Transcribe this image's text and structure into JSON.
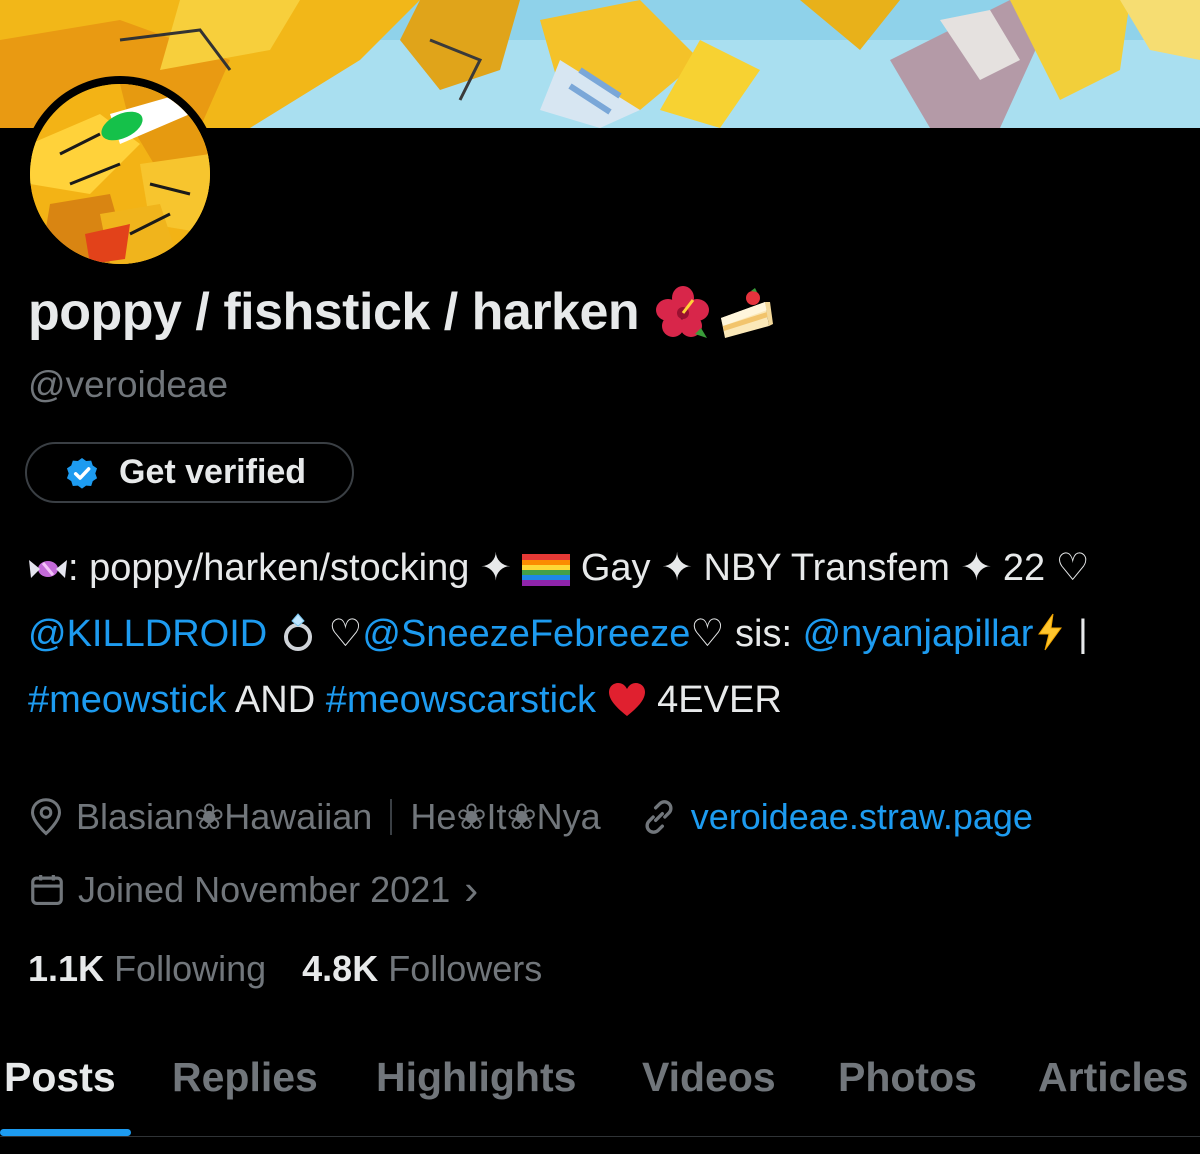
{
  "profile": {
    "display_name": "poppy / fishstick / harken",
    "name_emojis": [
      "hibiscus-icon",
      "cake-icon"
    ],
    "handle": "@veroideae",
    "get_verified_label": "Get verified"
  },
  "bio": {
    "t1": ": poppy/harken/stocking ✦ ",
    "t2": " Gay ✦ NBY Transfem ✦ 22 ♡ ",
    "mention1": "@KILLDROID",
    "t3": " ",
    "t4": " ♡",
    "mention2": "@SneezeFebreeze",
    "t5": "♡ sis: ",
    "mention3": "@nyanjapillar",
    "t6": " | ",
    "hashtag1": "#meowstick",
    "t7": " AND ",
    "hashtag2": "#meowscarstick",
    "t8": " ",
    "t9": " 4EVER"
  },
  "meta": {
    "location": "Blasian❀Hawaiian",
    "pronouns": "He❀It❀Nya",
    "website": "veroideae.straw.page",
    "joined": "Joined November 2021",
    "joined_chevron": "›"
  },
  "stats": {
    "following_count": "1.1K",
    "following_label": "Following",
    "followers_count": "4.8K",
    "followers_label": "Followers"
  },
  "tabs": [
    {
      "label": "Posts",
      "active": true
    },
    {
      "label": "Replies"
    },
    {
      "label": "Highlights"
    },
    {
      "label": "Videos"
    },
    {
      "label": "Photos"
    },
    {
      "label": "Articles"
    }
  ],
  "colors": {
    "accent": "#1d9bf0",
    "text": "#e7e9ea",
    "muted": "#71767b",
    "background": "#000000"
  }
}
